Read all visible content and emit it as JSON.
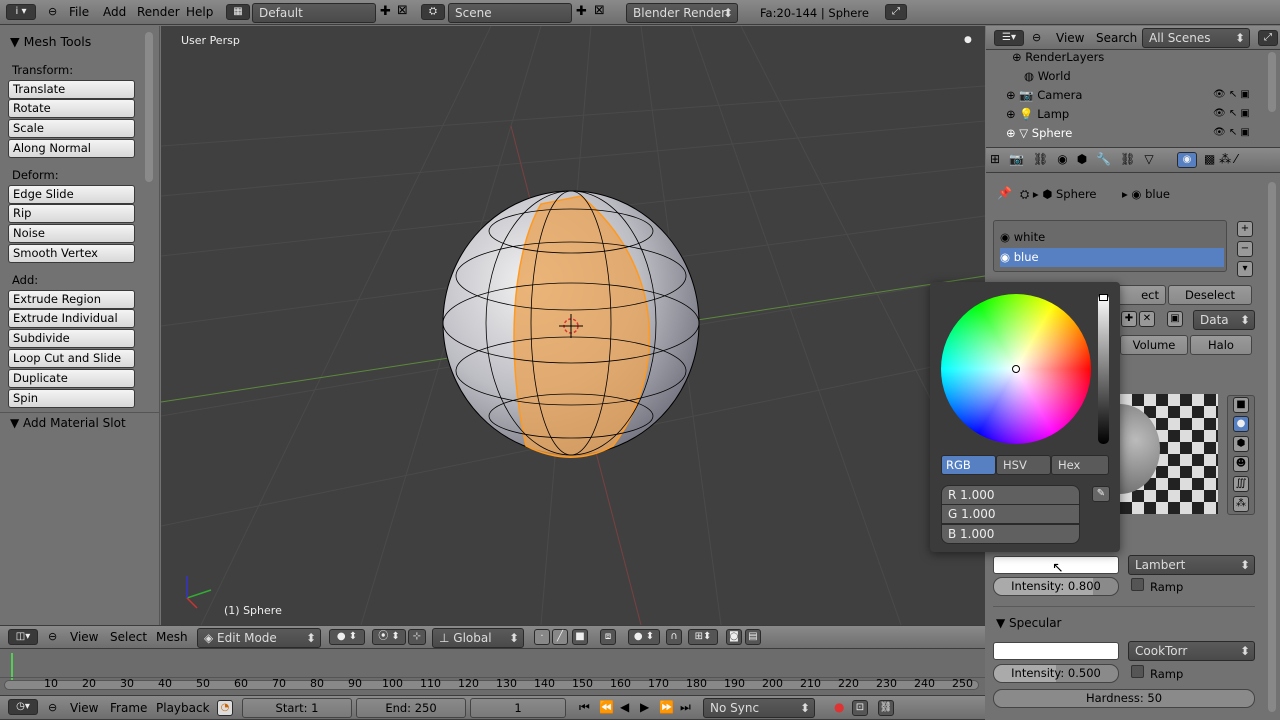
{
  "top": {
    "menus": [
      "File",
      "Add",
      "Render",
      "Help"
    ],
    "layout": "Default",
    "scene": "Scene",
    "engine": "Blender Render",
    "stats": "Fa:20-144 | Sphere"
  },
  "toolshelf": {
    "title": "Mesh Tools",
    "transform_label": "Transform:",
    "transform": [
      "Translate",
      "Rotate",
      "Scale",
      "Along Normal"
    ],
    "deform_label": "Deform:",
    "deform": [
      "Edge Slide",
      "Rip",
      "Noise",
      "Smooth Vertex"
    ],
    "add_label": "Add:",
    "add": [
      "Extrude Region",
      "Extrude Individual",
      "Subdivide",
      "Loop Cut and Slide",
      "Duplicate",
      "Spin"
    ],
    "operator": "Add Material Slot"
  },
  "viewport": {
    "label": "User Persp",
    "object": "(1) Sphere"
  },
  "viewheader": {
    "menus": [
      "View",
      "Select",
      "Mesh"
    ],
    "mode": "Edit Mode",
    "orientation": "Global"
  },
  "timeline": {
    "ticks": [
      "10",
      "20",
      "30",
      "40",
      "50",
      "60",
      "70",
      "80",
      "90",
      "100",
      "110",
      "120",
      "130",
      "140",
      "150",
      "160",
      "170",
      "180",
      "190",
      "200",
      "210",
      "220",
      "230",
      "240",
      "250"
    ],
    "menus": [
      "View",
      "Frame",
      "Playback"
    ],
    "start": "Start: 1",
    "end": "End: 250",
    "frame": "1",
    "sync": "No Sync"
  },
  "outliner": {
    "menus": [
      "View",
      "Search"
    ],
    "filter": "All Scenes",
    "items": [
      "RenderLayers",
      "World",
      "Camera",
      "Lamp",
      "Sphere"
    ]
  },
  "props": {
    "breadcrumb_obj": "Sphere",
    "breadcrumb_mat": "blue",
    "slots": [
      "white",
      "blue"
    ],
    "select": "ect",
    "deselect": "Deselect",
    "data": "Data",
    "tabs": [
      "Volume",
      "Halo"
    ],
    "diffuse_shader": "Lambert",
    "diffuse_intensity": "Intensity: 0.800",
    "ramp": "Ramp",
    "specular_title": "Specular",
    "spec_shader": "CookTorr",
    "spec_intensity": "Intensity: 0.500",
    "spec_ramp": "Ramp",
    "hardness": "Hardness: 50"
  },
  "picker": {
    "modes": [
      "RGB",
      "HSV",
      "Hex"
    ],
    "r": "R 1.000",
    "g": "G 1.000",
    "b": "B 1.000"
  }
}
